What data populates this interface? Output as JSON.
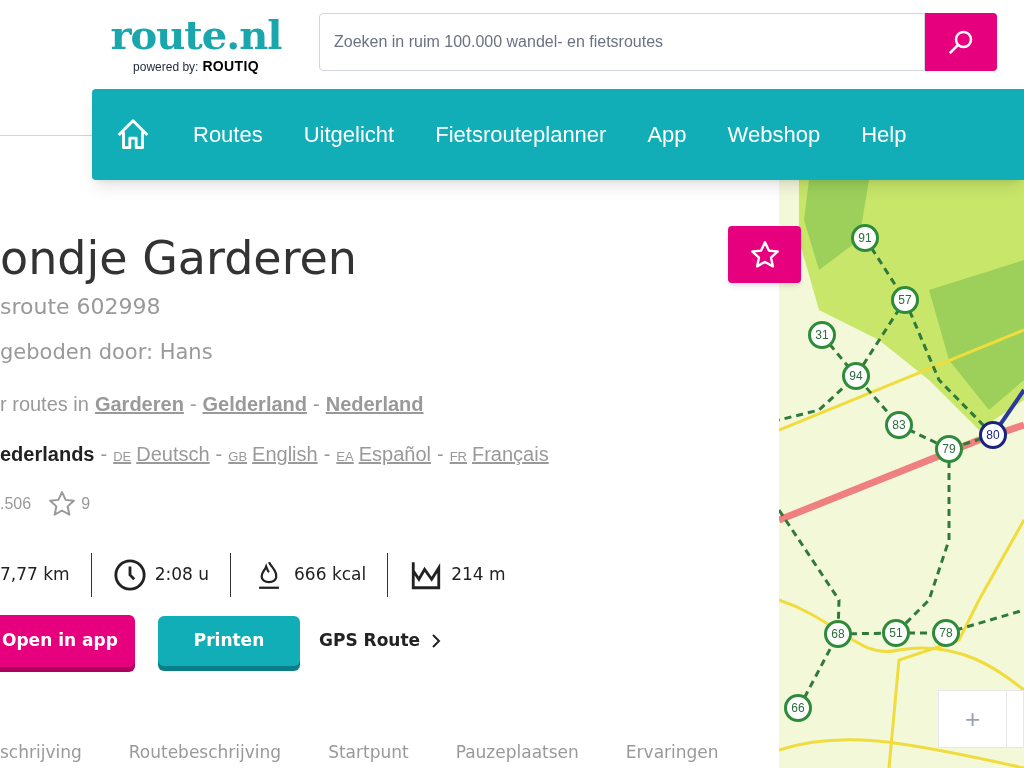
{
  "header": {
    "logo": "route.nl",
    "powered_by": "powered by:",
    "powered_brand": "ROUTIQ",
    "search": {
      "placeholder": "Zoeken in ruim 100.000 wandel- en fietsroutes"
    }
  },
  "nav": {
    "items": [
      "Routes",
      "Uitgelicht",
      "Fietsrouteplanner",
      "App",
      "Webshop",
      "Help"
    ]
  },
  "route": {
    "title": "ondje Garderen",
    "subtitle": "sroute 602998",
    "offered_by": "geboden door: Hans",
    "more_routes": {
      "prefix": "r routes in",
      "links": [
        {
          "label": "Garderen"
        },
        {
          "separator": "-",
          "label": "Gelderland"
        },
        {
          "separator": "-",
          "label": "Nederland"
        }
      ]
    },
    "languages": [
      {
        "name": "ederlands",
        "selected": true
      },
      {
        "separator": "-",
        "code": "DE",
        "name": "Deutsch",
        "selected": false
      },
      {
        "separator": "-",
        "code": "GB",
        "name": "English",
        "selected": false
      },
      {
        "separator": "-",
        "code": "EA",
        "name": "Español",
        "selected": false
      },
      {
        "separator": "-",
        "code": "FR",
        "name": "Français",
        "selected": false
      }
    ],
    "views": ".506",
    "rating_count": "9",
    "stats": [
      {
        "kind": "distance",
        "value": "7,77 km"
      },
      {
        "kind": "duration",
        "value": "2:08 u"
      },
      {
        "kind": "calories",
        "value": "666 kcal"
      },
      {
        "kind": "elevation",
        "value": "214 m"
      }
    ],
    "buttons": [
      {
        "kind": "app",
        "label": "Open in app"
      },
      {
        "kind": "print",
        "label": "Printen"
      },
      {
        "kind": "gps",
        "label": "GPS Route"
      }
    ],
    "tabs": [
      "schrijving",
      "Routebeschrijving",
      "Startpunt",
      "Pauzeplaatsen",
      "Ervaringen"
    ]
  },
  "map": {
    "nodes": [
      {
        "label": "91",
        "kind": "network"
      },
      {
        "label": "57",
        "kind": "network"
      },
      {
        "label": "31",
        "kind": "network"
      },
      {
        "label": "94",
        "kind": "network"
      },
      {
        "label": "83",
        "kind": "network"
      },
      {
        "label": "79",
        "kind": "network"
      },
      {
        "label": "80",
        "kind": "route"
      },
      {
        "label": "68",
        "kind": "network"
      },
      {
        "label": "51",
        "kind": "network"
      },
      {
        "label": "78",
        "kind": "network"
      },
      {
        "label": "66",
        "kind": "network"
      }
    ],
    "zoom_in": "+"
  }
}
